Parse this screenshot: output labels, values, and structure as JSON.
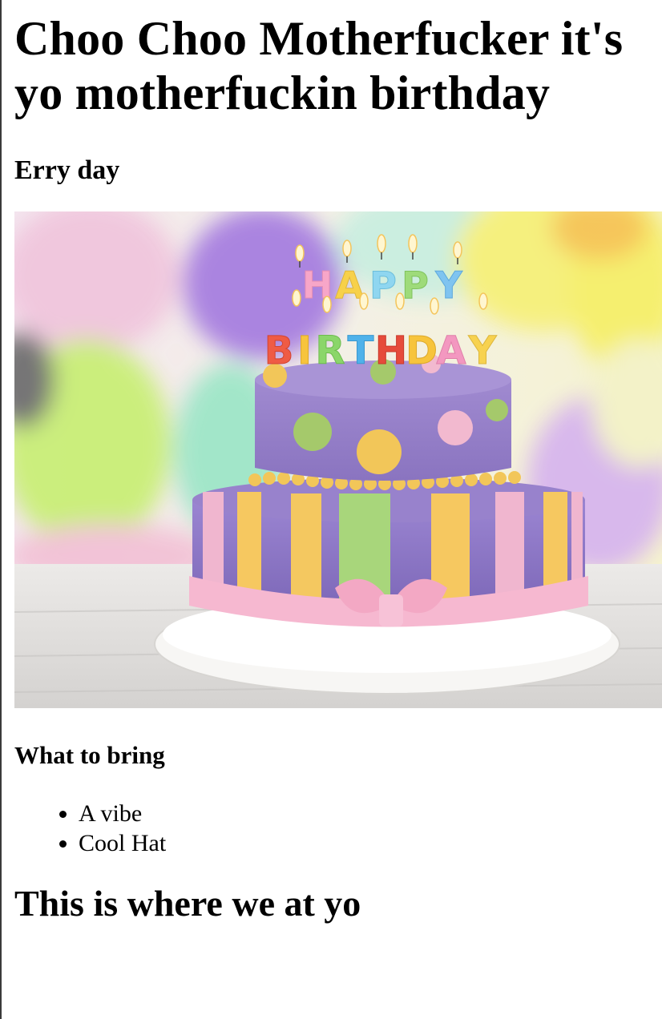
{
  "page": {
    "title": "Choo Choo Motherfucker it's yo motherfuckin birthday",
    "subtitle": "Erry day",
    "image": {
      "icon": "birthday-cake-photo",
      "candle_text_top": "HAPPY",
      "candle_text_bottom": "BIRTHDAY"
    },
    "bring_heading": "What to bring",
    "bring_items": [
      "A vibe",
      "Cool Hat"
    ],
    "location_heading": "This is where we at yo"
  },
  "colors": {
    "text": "#000000",
    "background": "#ffffff"
  }
}
